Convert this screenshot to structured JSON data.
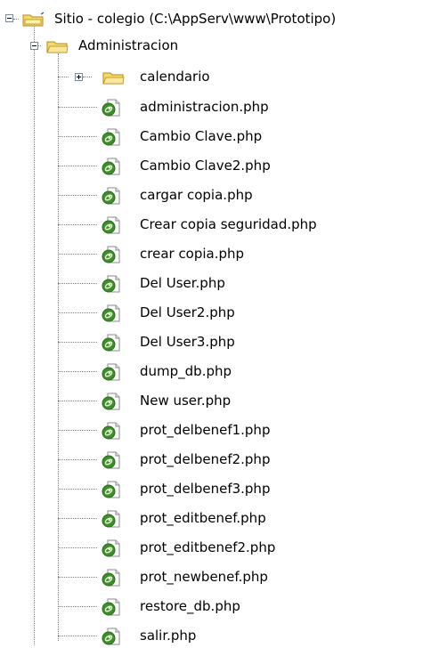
{
  "tree": {
    "root": {
      "label": "Sitio - colegio (C:\\AppServ\\www\\Prototipo)",
      "expander": "minus",
      "icon": "site-folder-icon"
    },
    "folder": {
      "label": "Administracion",
      "expander": "minus",
      "icon": "folder-icon"
    },
    "subfolder": {
      "label": "calendario",
      "expander": "plus",
      "icon": "folder-icon"
    },
    "files": [
      "administracion.php",
      "Cambio Clave.php",
      "Cambio Clave2.php",
      "cargar copia.php",
      "Crear copia seguridad.php",
      "crear copia.php",
      "Del User.php",
      "Del User2.php",
      "Del User3.php",
      "dump_db.php",
      "New user.php",
      "prot_delbenef1.php",
      "prot_delbenef2.php",
      "prot_delbenef3.php",
      "prot_editbenef.php",
      "prot_editbenef2.php",
      "prot_newbenef.php",
      "restore_db.php",
      "salir.php"
    ],
    "file_icon": "php-file-icon",
    "colors": {
      "connector": "#808080",
      "folder_fill": "#f5d96a",
      "folder_stroke": "#b58a1b",
      "php_icon": "#3c8f2a"
    }
  }
}
